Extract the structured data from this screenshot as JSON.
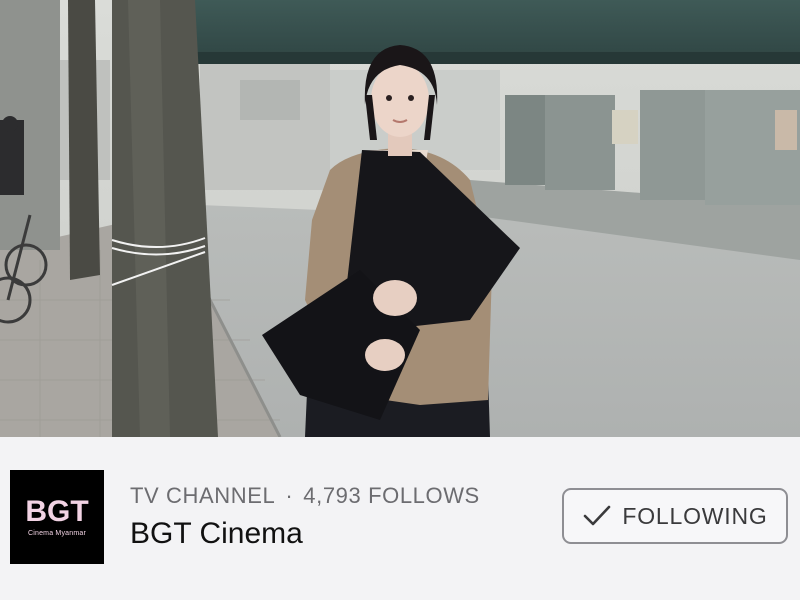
{
  "cover": {
    "icon": "cover-photo"
  },
  "channel": {
    "logo_text": "BGT",
    "logo_subtext": "Cinema Myanmar",
    "category": "TV CHANNEL",
    "separator": "·",
    "follows": "4,793 FOLLOWS",
    "name": "BGT Cinema"
  },
  "actions": {
    "follow_label": "FOLLOWING",
    "follow_icon": "check-icon"
  },
  "colors": {
    "logo_bg": "#000000",
    "logo_text": "#f2d3e4",
    "meta_text": "#6c6c70",
    "name_text": "#111111",
    "button_border": "#8e8e93"
  }
}
